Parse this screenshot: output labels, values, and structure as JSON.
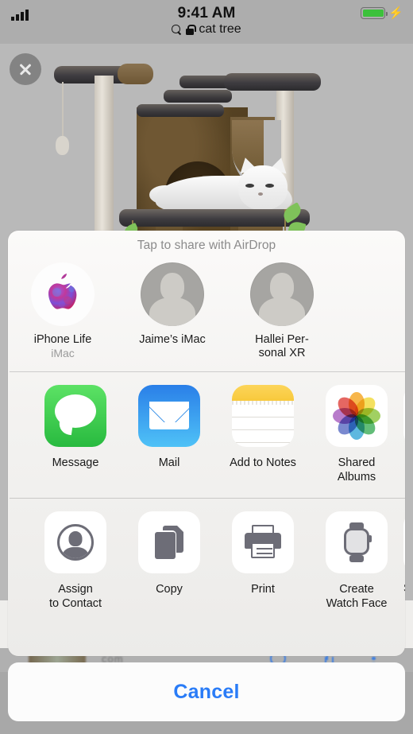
{
  "status_bar": {
    "time": "9:41 AM",
    "signal_icon": "cellular-signal-icon",
    "signal_bars": 4,
    "battery_icon": "battery-full-icon",
    "charging_icon": "lightning-bolt-icon",
    "battery_color": "#3cc13b"
  },
  "address_bar": {
    "search_icon": "search-icon",
    "lock_icon": "lock-icon",
    "query": "cat tree"
  },
  "photo_viewer": {
    "close_icon": "close-x-icon",
    "subject": "cat tree with white cat"
  },
  "share_sheet": {
    "title": "Tap to share with AirDrop",
    "airdrop": [
      {
        "name": "iPhone Life",
        "subtitle": "iMac",
        "avatar": "apple-logo-avatar"
      },
      {
        "name": "Jaime’s iMac",
        "subtitle": "",
        "avatar": "person-silhouette-avatar"
      },
      {
        "name": "Hallei Per-\nsonal XR",
        "subtitle": "",
        "avatar": "person-silhouette-avatar"
      }
    ],
    "apps": [
      {
        "label": "Message",
        "icon": "messages-app-icon"
      },
      {
        "label": "Mail",
        "icon": "mail-app-icon"
      },
      {
        "label": "Add to Notes",
        "icon": "notes-app-icon"
      },
      {
        "label": "Shared\nAlbums",
        "icon": "photos-app-icon"
      },
      {
        "label": "",
        "icon": "more-apps-icon"
      }
    ],
    "actions": [
      {
        "label": "Assign\nto Contact",
        "icon": "assign-to-contact-icon"
      },
      {
        "label": "Copy",
        "icon": "copy-icon"
      },
      {
        "label": "Print",
        "icon": "printer-icon"
      },
      {
        "label": "Create\nWatch Face",
        "icon": "apple-watch-icon"
      },
      {
        "label": "Sa",
        "icon": "save-image-icon"
      }
    ]
  },
  "cancel_button": {
    "label": "Cancel",
    "color": "#2a7cf7"
  },
  "background_toolbar": {
    "text": "com",
    "reload_icon": "reload-icon",
    "share_icon": "share-icon",
    "more_icon": "more-dots-icon"
  }
}
